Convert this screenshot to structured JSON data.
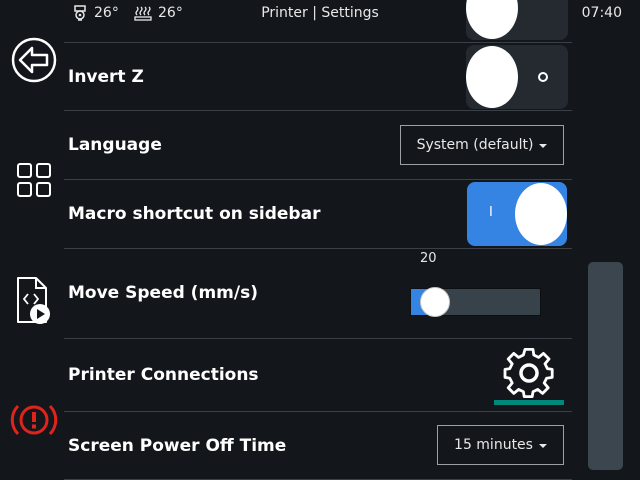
{
  "status": {
    "extruder_temp": "26°",
    "bed_temp": "26°",
    "title": "Printer | Settings",
    "time": "07:40"
  },
  "sidebar": {
    "items": [
      {
        "icon": "back-arrow-icon"
      },
      {
        "icon": "grid-menu-icon"
      },
      {
        "icon": "gcode-file-play-icon"
      },
      {
        "icon": "emergency-stop-icon"
      }
    ]
  },
  "settings": {
    "invert_z": {
      "label": "Invert Z",
      "state": "off"
    },
    "language": {
      "label": "Language",
      "value": "System (default)"
    },
    "macro_shortcut": {
      "label": "Macro shortcut on sidebar",
      "state": "on",
      "on_mark": "I"
    },
    "move_speed": {
      "label": "Move Speed (mm/s)",
      "value": "20",
      "fraction": 0.05
    },
    "printer_connections": {
      "label": "Printer Connections"
    },
    "screen_power_off": {
      "label": "Screen Power Off Time",
      "value": "15 minutes"
    }
  },
  "colors": {
    "accent": "#3584e4",
    "background": "#13171b",
    "toggle_off": "#242a30",
    "emergency": "#e0241b",
    "connection_underline": "#00897b"
  }
}
